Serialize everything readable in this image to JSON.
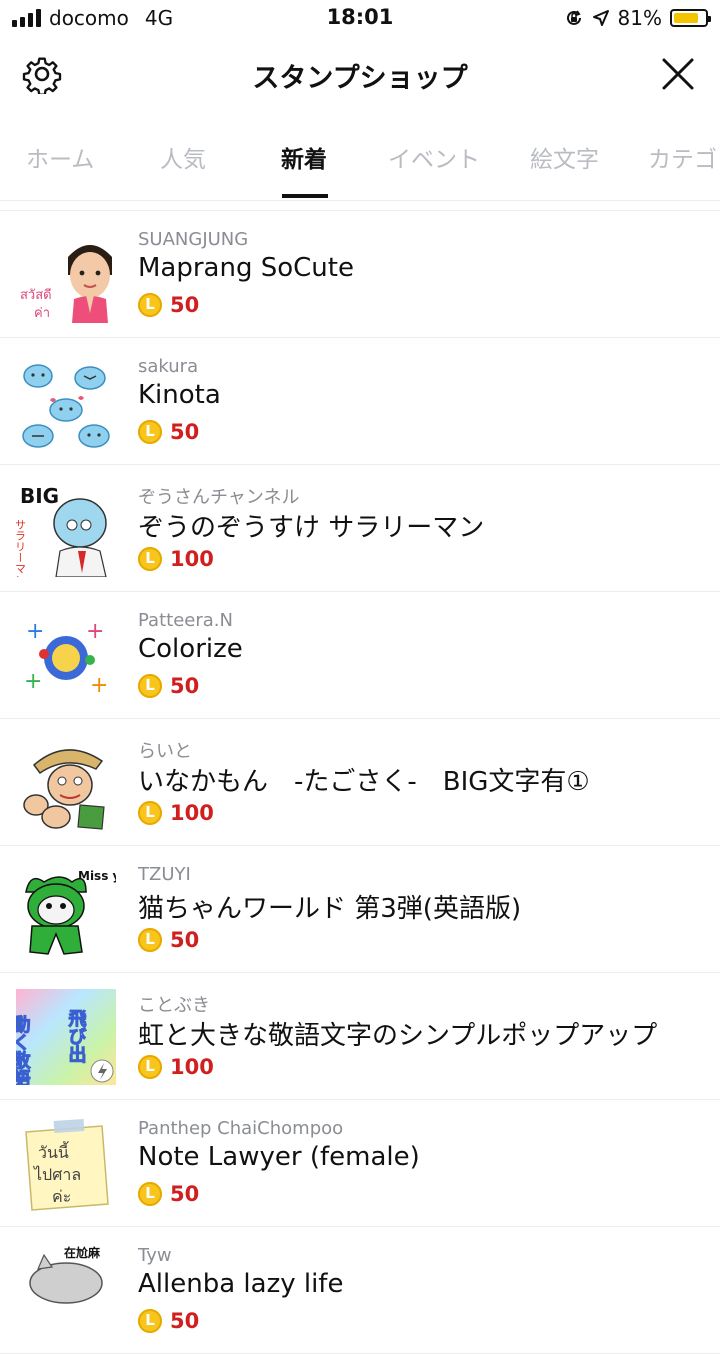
{
  "status_bar": {
    "carrier": "docomo",
    "network": "4G",
    "time": "18:01",
    "battery": "81%",
    "battery_level": 0.81
  },
  "nav": {
    "title": "スタンプショップ"
  },
  "tabs": [
    {
      "label": "ホーム"
    },
    {
      "label": "人気"
    },
    {
      "label": "新着",
      "active": true
    },
    {
      "label": "イベント"
    },
    {
      "label": "絵文字"
    },
    {
      "label": "カテゴ"
    }
  ],
  "coin_glyph": "L",
  "items": [
    {
      "author": "SUANGJUNG",
      "title": "Maprang SoCute",
      "price": "50"
    },
    {
      "author": "sakura",
      "title": "Kinota",
      "price": "50"
    },
    {
      "author": "ぞうさんチャンネル",
      "title": "ぞうのぞうすけ サラリーマン",
      "price": "100",
      "thumb_text": "BIG",
      "thumb_text2": "サラリーマン"
    },
    {
      "author": "Patteera.N",
      "title": "Colorize",
      "price": "50"
    },
    {
      "author": "らいと",
      "title": "いなかもん　-たごさく-　BIG文字有①",
      "price": "100"
    },
    {
      "author": "TZUYI",
      "title": "猫ちゃんワールド 第3弾(英語版)",
      "price": "50",
      "thumb_text": "Miss you"
    },
    {
      "author": "ことぶき",
      "title": "虹と大きな敬語文字のシンプルポップアップ",
      "price": "100",
      "thumb_text": "動く敬語",
      "thumb_text2": "飛び出"
    },
    {
      "author": "Panthep ChaiChompoo",
      "title": "Note Lawyer (female)",
      "price": "50"
    },
    {
      "author": "Tyw",
      "title": "Allenba lazy life",
      "price": "50",
      "thumb_text": "在尬麻"
    }
  ],
  "colors": {
    "price": "#d01f1f",
    "coin": "#f7c51b",
    "tab_inactive": "#b9bcc2",
    "author": "#8a8d93"
  }
}
